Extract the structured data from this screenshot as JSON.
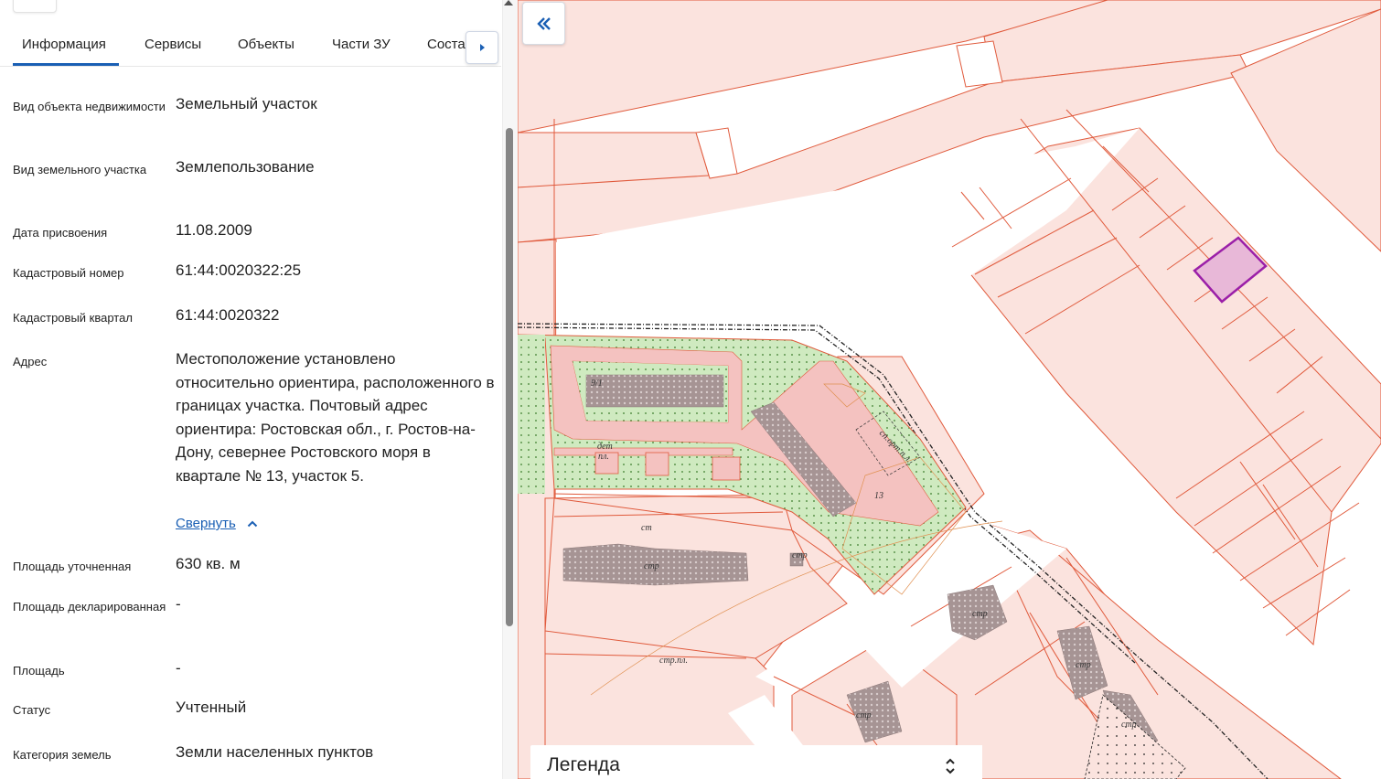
{
  "tabs": [
    "Информация",
    "Сервисы",
    "Объекты",
    "Части ЗУ",
    "Соста"
  ],
  "info": {
    "object_type_label": "Вид объекта недвижимости",
    "object_type_value": "Земельный участок",
    "land_type_label": "Вид земельного участка",
    "land_type_value": "Землепользование",
    "date_label": "Дата присвоения",
    "date_value": "11.08.2009",
    "cad_number_label": "Кадастровый номер",
    "cad_number_value": "61:44:0020322:25",
    "cad_quarter_label": "Кадастровый квартал",
    "cad_quarter_value": "61:44:0020322",
    "address_label": "Адрес",
    "address_value": "Местоположение установлено относительно ориентира, расположенного в границах участка. Почтовый адрес ориентира: Ростовская обл., г. Ростов-на-Дону, севернее Ростовского моря в квартале № 13, участок 5.",
    "collapse_link": "Свернуть",
    "area_refined_label": "Площадь уточненная",
    "area_refined_value": "630 кв. м",
    "area_declared_label": "Площадь декларированная",
    "area_declared_value": "-",
    "area_label": "Площадь",
    "area_value": "-",
    "status_label": "Статус",
    "status_value": "Учтенный",
    "land_category_label": "Категория земель",
    "land_category_value": "Земли населенных пунктов"
  },
  "map": {
    "labels": {
      "det_pl_1": "дет",
      "det_pl_2": "пл.",
      "sport_pl": "сп.орт.п.л.",
      "str_1": "стр",
      "str_pl": "стр.пл.",
      "str_2": "стр",
      "str_3": "стр",
      "str_4": "стр",
      "str_5": "стр",
      "str_6": "стр",
      "st": "ст",
      "sh1": "9/1",
      "n13": "13"
    },
    "colors": {
      "parcel_fill": "#fbe3de",
      "parcel_line": "#e05a3c",
      "selected_fill": "#e8b8d8",
      "selected_line": "#9b1fa8",
      "green": "#cfeac0",
      "road_pink": "#f4c2c0",
      "building": "#a89090"
    }
  },
  "legend": {
    "title": "Легенда"
  },
  "colors": {
    "accent": "#1a5fb4"
  }
}
